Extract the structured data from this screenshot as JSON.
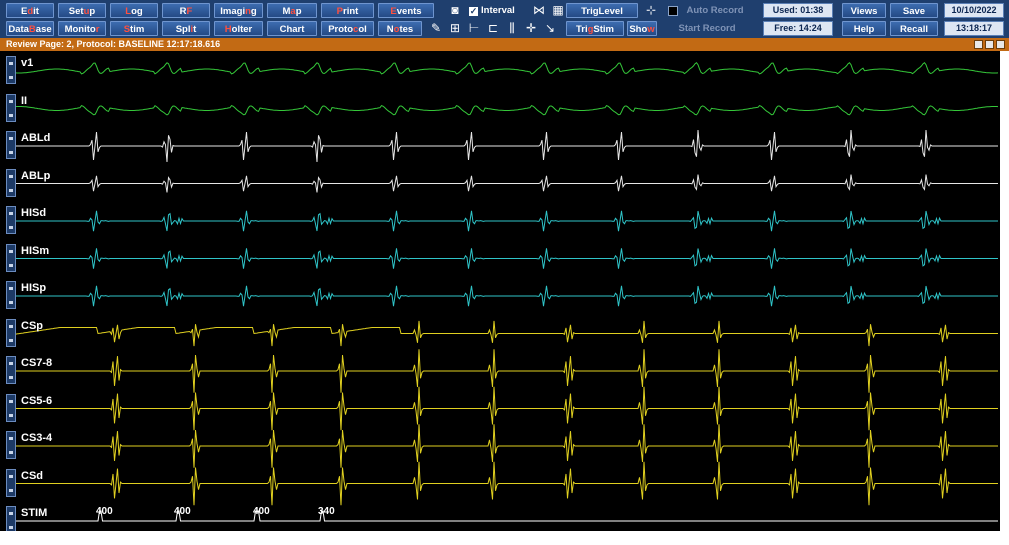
{
  "toolbar": {
    "row1": [
      {
        "id": "edit",
        "pre": "E",
        "hk": "d",
        "post": "it"
      },
      {
        "id": "setup",
        "pre": "Set",
        "hk": "u",
        "post": "p"
      },
      {
        "id": "log",
        "pre": "",
        "hk": "L",
        "post": "og"
      },
      {
        "id": "rf",
        "pre": "R",
        "hk": "F",
        "post": ""
      },
      {
        "id": "imaging",
        "pre": "Imagi",
        "hk": "n",
        "post": "g"
      },
      {
        "id": "map",
        "pre": "M",
        "hk": "a",
        "post": "p"
      },
      {
        "id": "print",
        "pre": "",
        "hk": "P",
        "post": "rint"
      },
      {
        "id": "events",
        "pre": "",
        "hk": "E",
        "post": "vents"
      }
    ],
    "row2": [
      {
        "id": "database",
        "pre": "Data",
        "hk": "B",
        "post": "ase"
      },
      {
        "id": "monitor",
        "pre": "Monito",
        "hk": "r",
        "post": ""
      },
      {
        "id": "stim",
        "pre": "",
        "hk": "S",
        "post": "tim"
      },
      {
        "id": "split",
        "pre": "Spl",
        "hk": "i",
        "post": "t"
      },
      {
        "id": "holter",
        "pre": "",
        "hk": "H",
        "post": "olter"
      },
      {
        "id": "chart",
        "pre": "Chart",
        "hk": "",
        "post": ""
      },
      {
        "id": "protocol",
        "pre": "Proto",
        "hk": "c",
        "post": "ol"
      },
      {
        "id": "notes",
        "pre": "N",
        "hk": "o",
        "post": "tes"
      }
    ],
    "interval_label": "Interval",
    "interval_checked": "✓",
    "trig_level": "TrigLevel",
    "trig_stim": {
      "pre": "Tri",
      "hk": "g",
      "post": "Stim"
    },
    "show": {
      "pre": "Sho",
      "hk": "w",
      "post": ""
    },
    "auto_record": "Auto Record",
    "start_record": "Start Record",
    "used": "Used: 01:38",
    "free": "Free: 14:24",
    "views": "Views",
    "save": "Save",
    "help": "Help",
    "recall": "Recall",
    "date": "10/10/2022",
    "time": "13:18:17"
  },
  "review": {
    "text": "Review Page: 2, Protocol: BASELINE   12:17:18.616"
  },
  "channels": [
    {
      "name": "v1",
      "color": "#35c83a"
    },
    {
      "name": "II",
      "color": "#35c83a"
    },
    {
      "name": "ABLd",
      "color": "#e6e6e6"
    },
    {
      "name": "ABLp",
      "color": "#e6e6e6"
    },
    {
      "name": "HISd",
      "color": "#2fc4c8"
    },
    {
      "name": "HISm",
      "color": "#2fc4c8"
    },
    {
      "name": "HISp",
      "color": "#2fc4c8"
    },
    {
      "name": "CSp",
      "color": "#e0d020"
    },
    {
      "name": "CS7-8",
      "color": "#e0d020"
    },
    {
      "name": "CS5-6",
      "color": "#e0d020"
    },
    {
      "name": "CS3-4",
      "color": "#e0d020"
    },
    {
      "name": "CSd",
      "color": "#e0d020"
    },
    {
      "name": "STIM",
      "color": "#ffffff"
    }
  ],
  "stim_cycle_lengths": [
    "400",
    "400",
    "400",
    "340"
  ]
}
